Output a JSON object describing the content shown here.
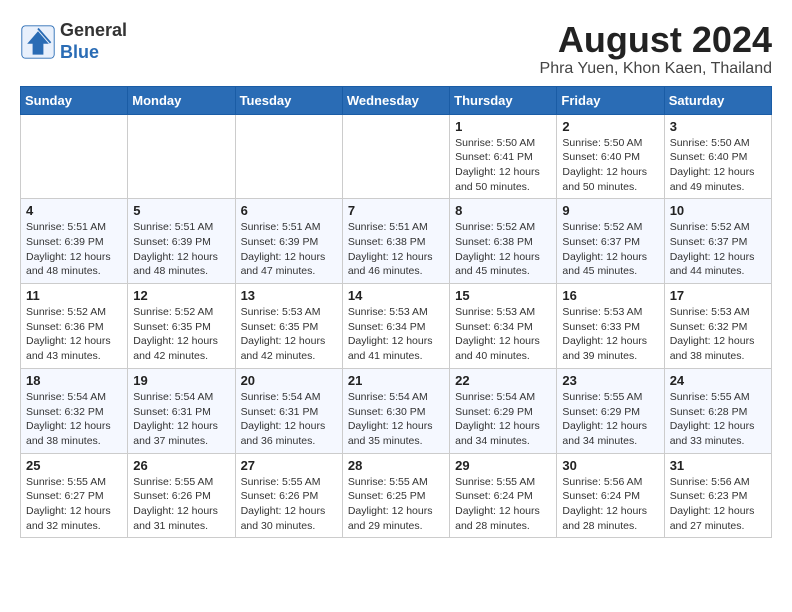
{
  "logo": {
    "general": "General",
    "blue": "Blue"
  },
  "title": "August 2024",
  "subtitle": "Phra Yuen, Khon Kaen, Thailand",
  "headers": [
    "Sunday",
    "Monday",
    "Tuesday",
    "Wednesday",
    "Thursday",
    "Friday",
    "Saturday"
  ],
  "weeks": [
    [
      {
        "day": "",
        "info": ""
      },
      {
        "day": "",
        "info": ""
      },
      {
        "day": "",
        "info": ""
      },
      {
        "day": "",
        "info": ""
      },
      {
        "day": "1",
        "info": "Sunrise: 5:50 AM\nSunset: 6:41 PM\nDaylight: 12 hours\nand 50 minutes."
      },
      {
        "day": "2",
        "info": "Sunrise: 5:50 AM\nSunset: 6:40 PM\nDaylight: 12 hours\nand 50 minutes."
      },
      {
        "day": "3",
        "info": "Sunrise: 5:50 AM\nSunset: 6:40 PM\nDaylight: 12 hours\nand 49 minutes."
      }
    ],
    [
      {
        "day": "4",
        "info": "Sunrise: 5:51 AM\nSunset: 6:39 PM\nDaylight: 12 hours\nand 48 minutes."
      },
      {
        "day": "5",
        "info": "Sunrise: 5:51 AM\nSunset: 6:39 PM\nDaylight: 12 hours\nand 48 minutes."
      },
      {
        "day": "6",
        "info": "Sunrise: 5:51 AM\nSunset: 6:39 PM\nDaylight: 12 hours\nand 47 minutes."
      },
      {
        "day": "7",
        "info": "Sunrise: 5:51 AM\nSunset: 6:38 PM\nDaylight: 12 hours\nand 46 minutes."
      },
      {
        "day": "8",
        "info": "Sunrise: 5:52 AM\nSunset: 6:38 PM\nDaylight: 12 hours\nand 45 minutes."
      },
      {
        "day": "9",
        "info": "Sunrise: 5:52 AM\nSunset: 6:37 PM\nDaylight: 12 hours\nand 45 minutes."
      },
      {
        "day": "10",
        "info": "Sunrise: 5:52 AM\nSunset: 6:37 PM\nDaylight: 12 hours\nand 44 minutes."
      }
    ],
    [
      {
        "day": "11",
        "info": "Sunrise: 5:52 AM\nSunset: 6:36 PM\nDaylight: 12 hours\nand 43 minutes."
      },
      {
        "day": "12",
        "info": "Sunrise: 5:52 AM\nSunset: 6:35 PM\nDaylight: 12 hours\nand 42 minutes."
      },
      {
        "day": "13",
        "info": "Sunrise: 5:53 AM\nSunset: 6:35 PM\nDaylight: 12 hours\nand 42 minutes."
      },
      {
        "day": "14",
        "info": "Sunrise: 5:53 AM\nSunset: 6:34 PM\nDaylight: 12 hours\nand 41 minutes."
      },
      {
        "day": "15",
        "info": "Sunrise: 5:53 AM\nSunset: 6:34 PM\nDaylight: 12 hours\nand 40 minutes."
      },
      {
        "day": "16",
        "info": "Sunrise: 5:53 AM\nSunset: 6:33 PM\nDaylight: 12 hours\nand 39 minutes."
      },
      {
        "day": "17",
        "info": "Sunrise: 5:53 AM\nSunset: 6:32 PM\nDaylight: 12 hours\nand 38 minutes."
      }
    ],
    [
      {
        "day": "18",
        "info": "Sunrise: 5:54 AM\nSunset: 6:32 PM\nDaylight: 12 hours\nand 38 minutes."
      },
      {
        "day": "19",
        "info": "Sunrise: 5:54 AM\nSunset: 6:31 PM\nDaylight: 12 hours\nand 37 minutes."
      },
      {
        "day": "20",
        "info": "Sunrise: 5:54 AM\nSunset: 6:31 PM\nDaylight: 12 hours\nand 36 minutes."
      },
      {
        "day": "21",
        "info": "Sunrise: 5:54 AM\nSunset: 6:30 PM\nDaylight: 12 hours\nand 35 minutes."
      },
      {
        "day": "22",
        "info": "Sunrise: 5:54 AM\nSunset: 6:29 PM\nDaylight: 12 hours\nand 34 minutes."
      },
      {
        "day": "23",
        "info": "Sunrise: 5:55 AM\nSunset: 6:29 PM\nDaylight: 12 hours\nand 34 minutes."
      },
      {
        "day": "24",
        "info": "Sunrise: 5:55 AM\nSunset: 6:28 PM\nDaylight: 12 hours\nand 33 minutes."
      }
    ],
    [
      {
        "day": "25",
        "info": "Sunrise: 5:55 AM\nSunset: 6:27 PM\nDaylight: 12 hours\nand 32 minutes."
      },
      {
        "day": "26",
        "info": "Sunrise: 5:55 AM\nSunset: 6:26 PM\nDaylight: 12 hours\nand 31 minutes."
      },
      {
        "day": "27",
        "info": "Sunrise: 5:55 AM\nSunset: 6:26 PM\nDaylight: 12 hours\nand 30 minutes."
      },
      {
        "day": "28",
        "info": "Sunrise: 5:55 AM\nSunset: 6:25 PM\nDaylight: 12 hours\nand 29 minutes."
      },
      {
        "day": "29",
        "info": "Sunrise: 5:55 AM\nSunset: 6:24 PM\nDaylight: 12 hours\nand 28 minutes."
      },
      {
        "day": "30",
        "info": "Sunrise: 5:56 AM\nSunset: 6:24 PM\nDaylight: 12 hours\nand 28 minutes."
      },
      {
        "day": "31",
        "info": "Sunrise: 5:56 AM\nSunset: 6:23 PM\nDaylight: 12 hours\nand 27 minutes."
      }
    ]
  ]
}
